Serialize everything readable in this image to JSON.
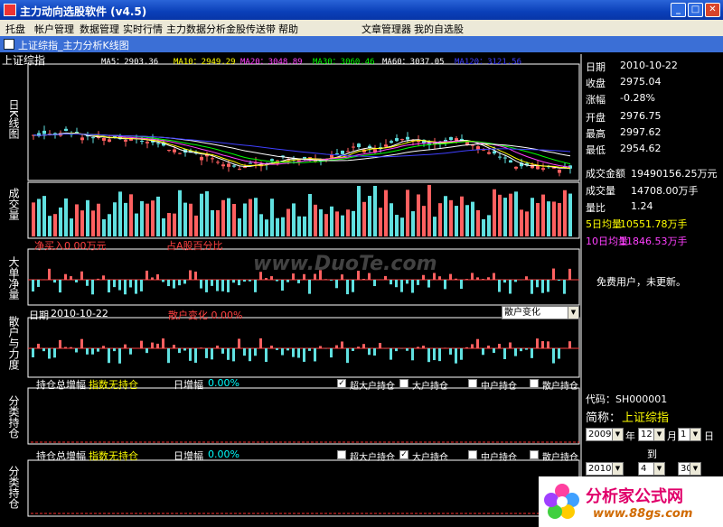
{
  "window": {
    "title": "主力动向选股软件 (v4.5)",
    "min": "_",
    "max": "□",
    "close": "✕"
  },
  "menu": [
    "托盘",
    "帐户管理",
    "数据管理",
    "实时行情",
    "主力数据分析",
    "金股传送带",
    "帮助",
    "文章管理器",
    "我的自选股"
  ],
  "doc_title": "上证综指_主力分析K线图",
  "chart_title": "上证综指",
  "ma": [
    {
      "label": "MA5：2903.36",
      "color": "#ffffff"
    },
    {
      "label": "MA10：2949.29",
      "color": "#ffff00"
    },
    {
      "label": "MA20：3048.89",
      "color": "#ff40ff"
    },
    {
      "label": "MA30：3060.46",
      "color": "#00ff00"
    },
    {
      "label": "MA60：3037.05",
      "color": "#ffffff"
    },
    {
      "label": "MA120：3121.56",
      "color": "#4040ff"
    }
  ],
  "labels": {
    "kline": "日K线图",
    "vol": "成交量",
    "bigorder": "大单净量",
    "retail": "散户与力度",
    "hold1": "分类持仓",
    "hold2": "分类持仓"
  },
  "panel2": {
    "left": "净买入0.00万元",
    "right": "占A股百分比"
  },
  "panel3": {
    "date_label": "日期",
    "date": "2010-10-22",
    "change": "散户变化 0.00%",
    "select": "散户变化"
  },
  "panel4": {
    "title": "持仓总增幅",
    "sub": "指数无持仓",
    "day": "日增幅",
    "pct": "0.00%",
    "checks": [
      {
        "label": "超大户持仓",
        "checked": true
      },
      {
        "label": "大户持仓",
        "checked": false
      },
      {
        "label": "中户持仓",
        "checked": false
      },
      {
        "label": "散户持仓",
        "checked": false
      }
    ]
  },
  "panel5": {
    "title": "持仓总增幅",
    "sub": "指数无持仓",
    "day": "日增幅",
    "pct": "0.00%",
    "checks": [
      {
        "label": "超大户持仓",
        "checked": false
      },
      {
        "label": "大户持仓",
        "checked": true
      },
      {
        "label": "中户持仓",
        "checked": false
      },
      {
        "label": "散户持仓",
        "checked": false
      }
    ]
  },
  "info": [
    {
      "k": "日期",
      "v": "2010-10-22",
      "c": "#ffffff"
    },
    {
      "k": "收盘",
      "v": "2975.04",
      "c": "#ffffff"
    },
    {
      "k": "涨幅",
      "v": "-0.28%",
      "c": "#ffffff"
    },
    {
      "k": "开盘",
      "v": "2976.75",
      "c": "#ffffff"
    },
    {
      "k": "最高",
      "v": "2997.62",
      "c": "#ffffff"
    },
    {
      "k": "最低",
      "v": "2954.62",
      "c": "#ffffff"
    },
    {
      "k": "成交金额",
      "v": "19490156.25万元",
      "c": "#ffffff"
    },
    {
      "k": "成交量",
      "v": "14708.00万手",
      "c": "#ffffff"
    },
    {
      "k": "量比",
      "v": "1.24",
      "c": "#ffffff"
    },
    {
      "k": "5日均量",
      "v": "10551.78万手",
      "c": "#ffff00"
    },
    {
      "k": "10日均量",
      "v": "11846.53万手",
      "c": "#ff40ff"
    }
  ],
  "notice": "免费用户，未更新。",
  "code": "代码：SH000001",
  "name_label": "简称：",
  "name": "上证综指",
  "date_sel": {
    "year": "2009",
    "y": "年",
    "month": "12",
    "m": "月",
    "day": "1",
    "d": "日",
    "to": "到",
    "year2": "2010",
    "month2": "4",
    "day2": "30"
  },
  "watermark": "www.DuoTe.com",
  "logo": {
    "text": "分析家公式网",
    "url": "www.88gs.com"
  }
}
